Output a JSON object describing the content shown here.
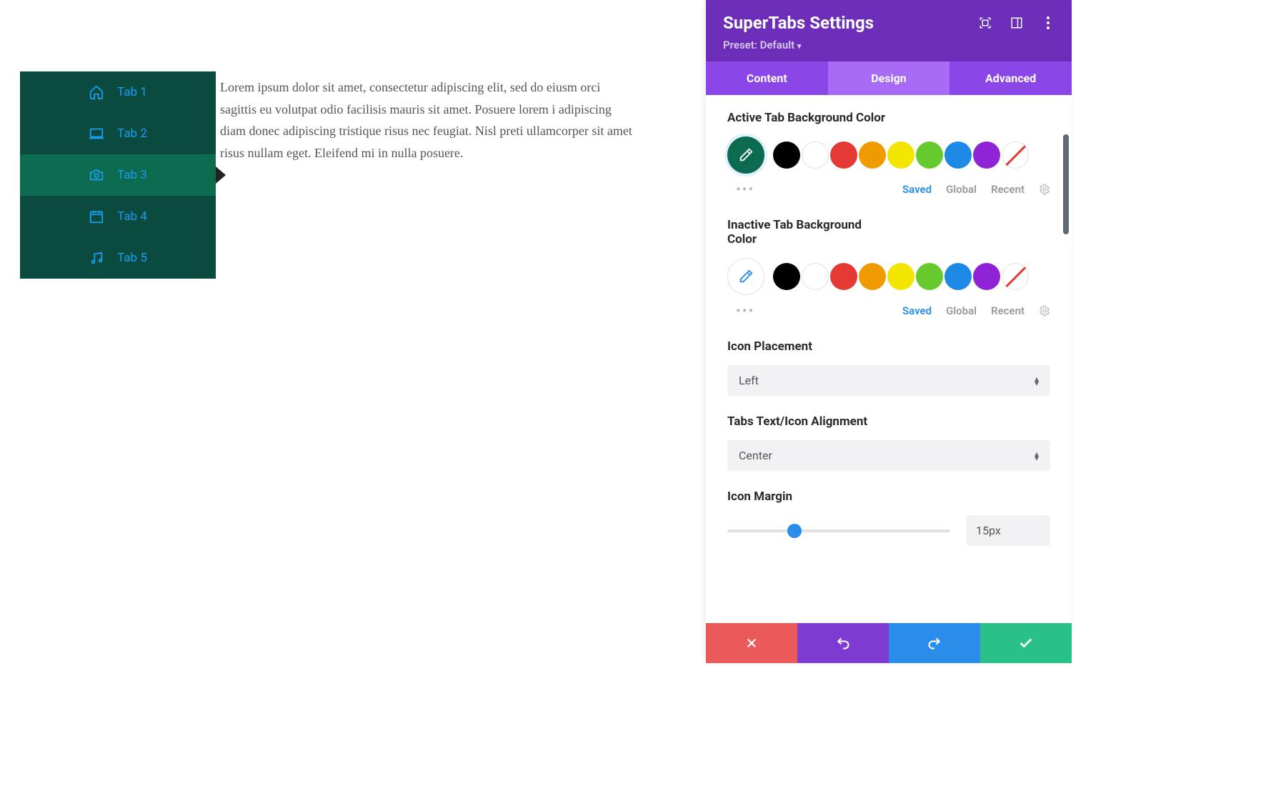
{
  "preview": {
    "tabs": [
      {
        "label": "Tab 1"
      },
      {
        "label": "Tab 2"
      },
      {
        "label": "Tab 3"
      },
      {
        "label": "Tab 4"
      },
      {
        "label": "Tab 5"
      }
    ],
    "active_index": 2,
    "content": "Lorem ipsum dolor sit amet, consectetur adipiscing elit, sed do eiusm orci sagittis eu volutpat odio facilisis mauris sit amet. Posuere lorem i adipiscing diam donec adipiscing tristique risus nec feugiat. Nisl preti ullamcorper sit amet risus nullam eget. Eleifend mi in nulla posuere.",
    "colors": {
      "inactive_bg": "#0b4a3f",
      "active_bg": "#0c6b4f",
      "text": "#1a9cf0"
    }
  },
  "panel": {
    "title": "SuperTabs Settings",
    "preset": "Preset: Default",
    "tabs": {
      "content": "Content",
      "design": "Design",
      "advanced": "Advanced",
      "active": "design"
    },
    "fields": {
      "active_bg": {
        "label": "Active Tab Background Color",
        "picker_color": "#0c6b4f",
        "picker_icon_color": "#ffffff"
      },
      "inactive_bg": {
        "label": "Inactive Tab Background Color",
        "picker_color": "#ffffff",
        "picker_icon_color": "#2a8de9"
      },
      "icon_placement": {
        "label": "Icon Placement",
        "value": "Left"
      },
      "text_align": {
        "label": "Tabs Text/Icon Alignment",
        "value": "Center"
      },
      "icon_margin": {
        "label": "Icon Margin",
        "value": "15px",
        "percent": 30
      }
    },
    "palette": [
      "#000000",
      "#ffffff",
      "#e53935",
      "#ef9b00",
      "#f2e500",
      "#66c92e",
      "#1e88e5",
      "#8e24d6"
    ],
    "meta": {
      "saved": "Saved",
      "global": "Global",
      "recent": "Recent"
    }
  }
}
